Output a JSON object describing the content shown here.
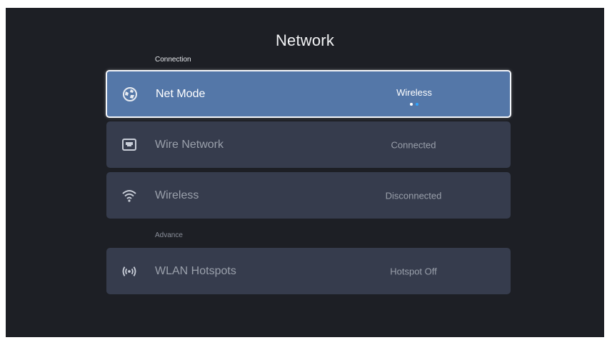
{
  "screen": {
    "title": "Network"
  },
  "sections": {
    "connection_label": "Connection",
    "advance_label": "Advance"
  },
  "rows": {
    "net_mode": {
      "label": "Net Mode",
      "value": "Wireless",
      "icon": "globe-icon"
    },
    "wire_network": {
      "label": "Wire Network",
      "value": "Connected",
      "icon": "ethernet-icon"
    },
    "wireless": {
      "label": "Wireless",
      "value": "Disconnected",
      "icon": "wifi-icon"
    },
    "wlan_hotspots": {
      "label": "WLAN Hotspots",
      "value": "Hotspot Off",
      "icon": "hotspot-icon"
    }
  },
  "colors": {
    "background": "#1d1f25",
    "row": "#363c4d",
    "row_focused": "#5477a8",
    "indicator_active": "#2ea4ff"
  }
}
